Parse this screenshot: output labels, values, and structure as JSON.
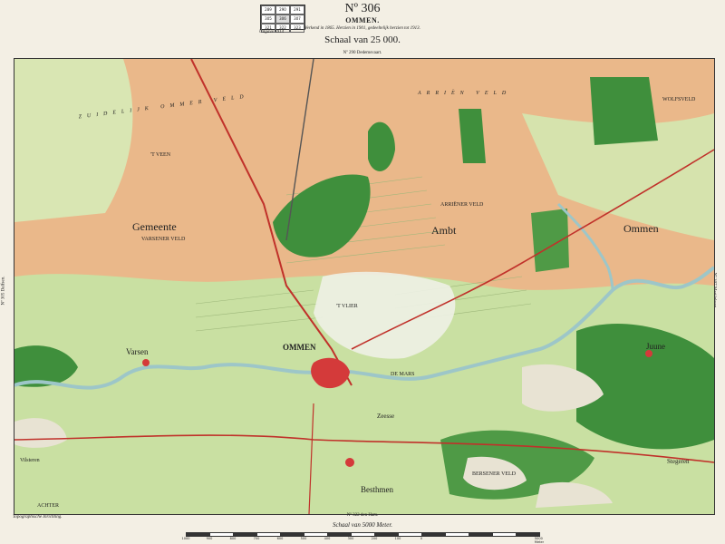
{
  "header": {
    "sheet_number": "Nº 306",
    "sheet_name": "OMMEN.",
    "revision_note": "Verkend in 1865. Herzien in 1901, gedeeltelijk herzien tot 1913.",
    "scale_title": "Schaal van 25 000.",
    "edition": "Uitgave 1914",
    "index_grid": [
      "289",
      "290",
      "291",
      "305",
      "306",
      "307",
      "321",
      "322",
      "323"
    ]
  },
  "neighbors": {
    "top": "Nº 290 Dedemsvaart.",
    "bottom": "Nº 322 den Ham.",
    "left": "Nº 305 Dalfsen.",
    "right": "Nº 307 Mariënberg."
  },
  "footer": {
    "credit": "Topographische Inrichting.",
    "scalebar_title": "Schaal van 5000 Meter.",
    "scalebar_ticks": [
      "1000",
      "900",
      "800",
      "700",
      "600",
      "500",
      "400",
      "300",
      "200",
      "100",
      "0",
      "",
      "",
      "",
      "",
      "5000 Meter"
    ]
  },
  "map_labels": {
    "zuidelijk": "ZUIDELIJK   OMMER   VELD",
    "arrien": "ARRIËN   VELD",
    "gemeente": "Gemeente",
    "ambt": "Ambt",
    "ommen_region": "Ommen",
    "ommen_town": "OMMEN",
    "varsen": "Varsen",
    "juune": "Juune",
    "besthmen": "Besthmen",
    "zeesse": "Zeesse",
    "stegeren": "Stegeren",
    "varsener_veld": "VARSENER VELD",
    "arriener_veld": "ARRIËNER VELD",
    "de_mars": "DE MARS",
    "vlier": "'T VLIER",
    "wolfsveld": "WOLFSVELD",
    "bersener_veld": "BERSENER VELD",
    "t_veen": "'T VEEN",
    "vilsteren": "Vilsteren",
    "achter": "ACHTER"
  },
  "colors": {
    "heath": "#eab88a",
    "meadow": "#c9e0a2",
    "forest": "#3f8f3c",
    "river": "#9dc6c8",
    "railway": "#c0312a",
    "town": "#d43a3a",
    "sand": "#e8e3d3"
  }
}
